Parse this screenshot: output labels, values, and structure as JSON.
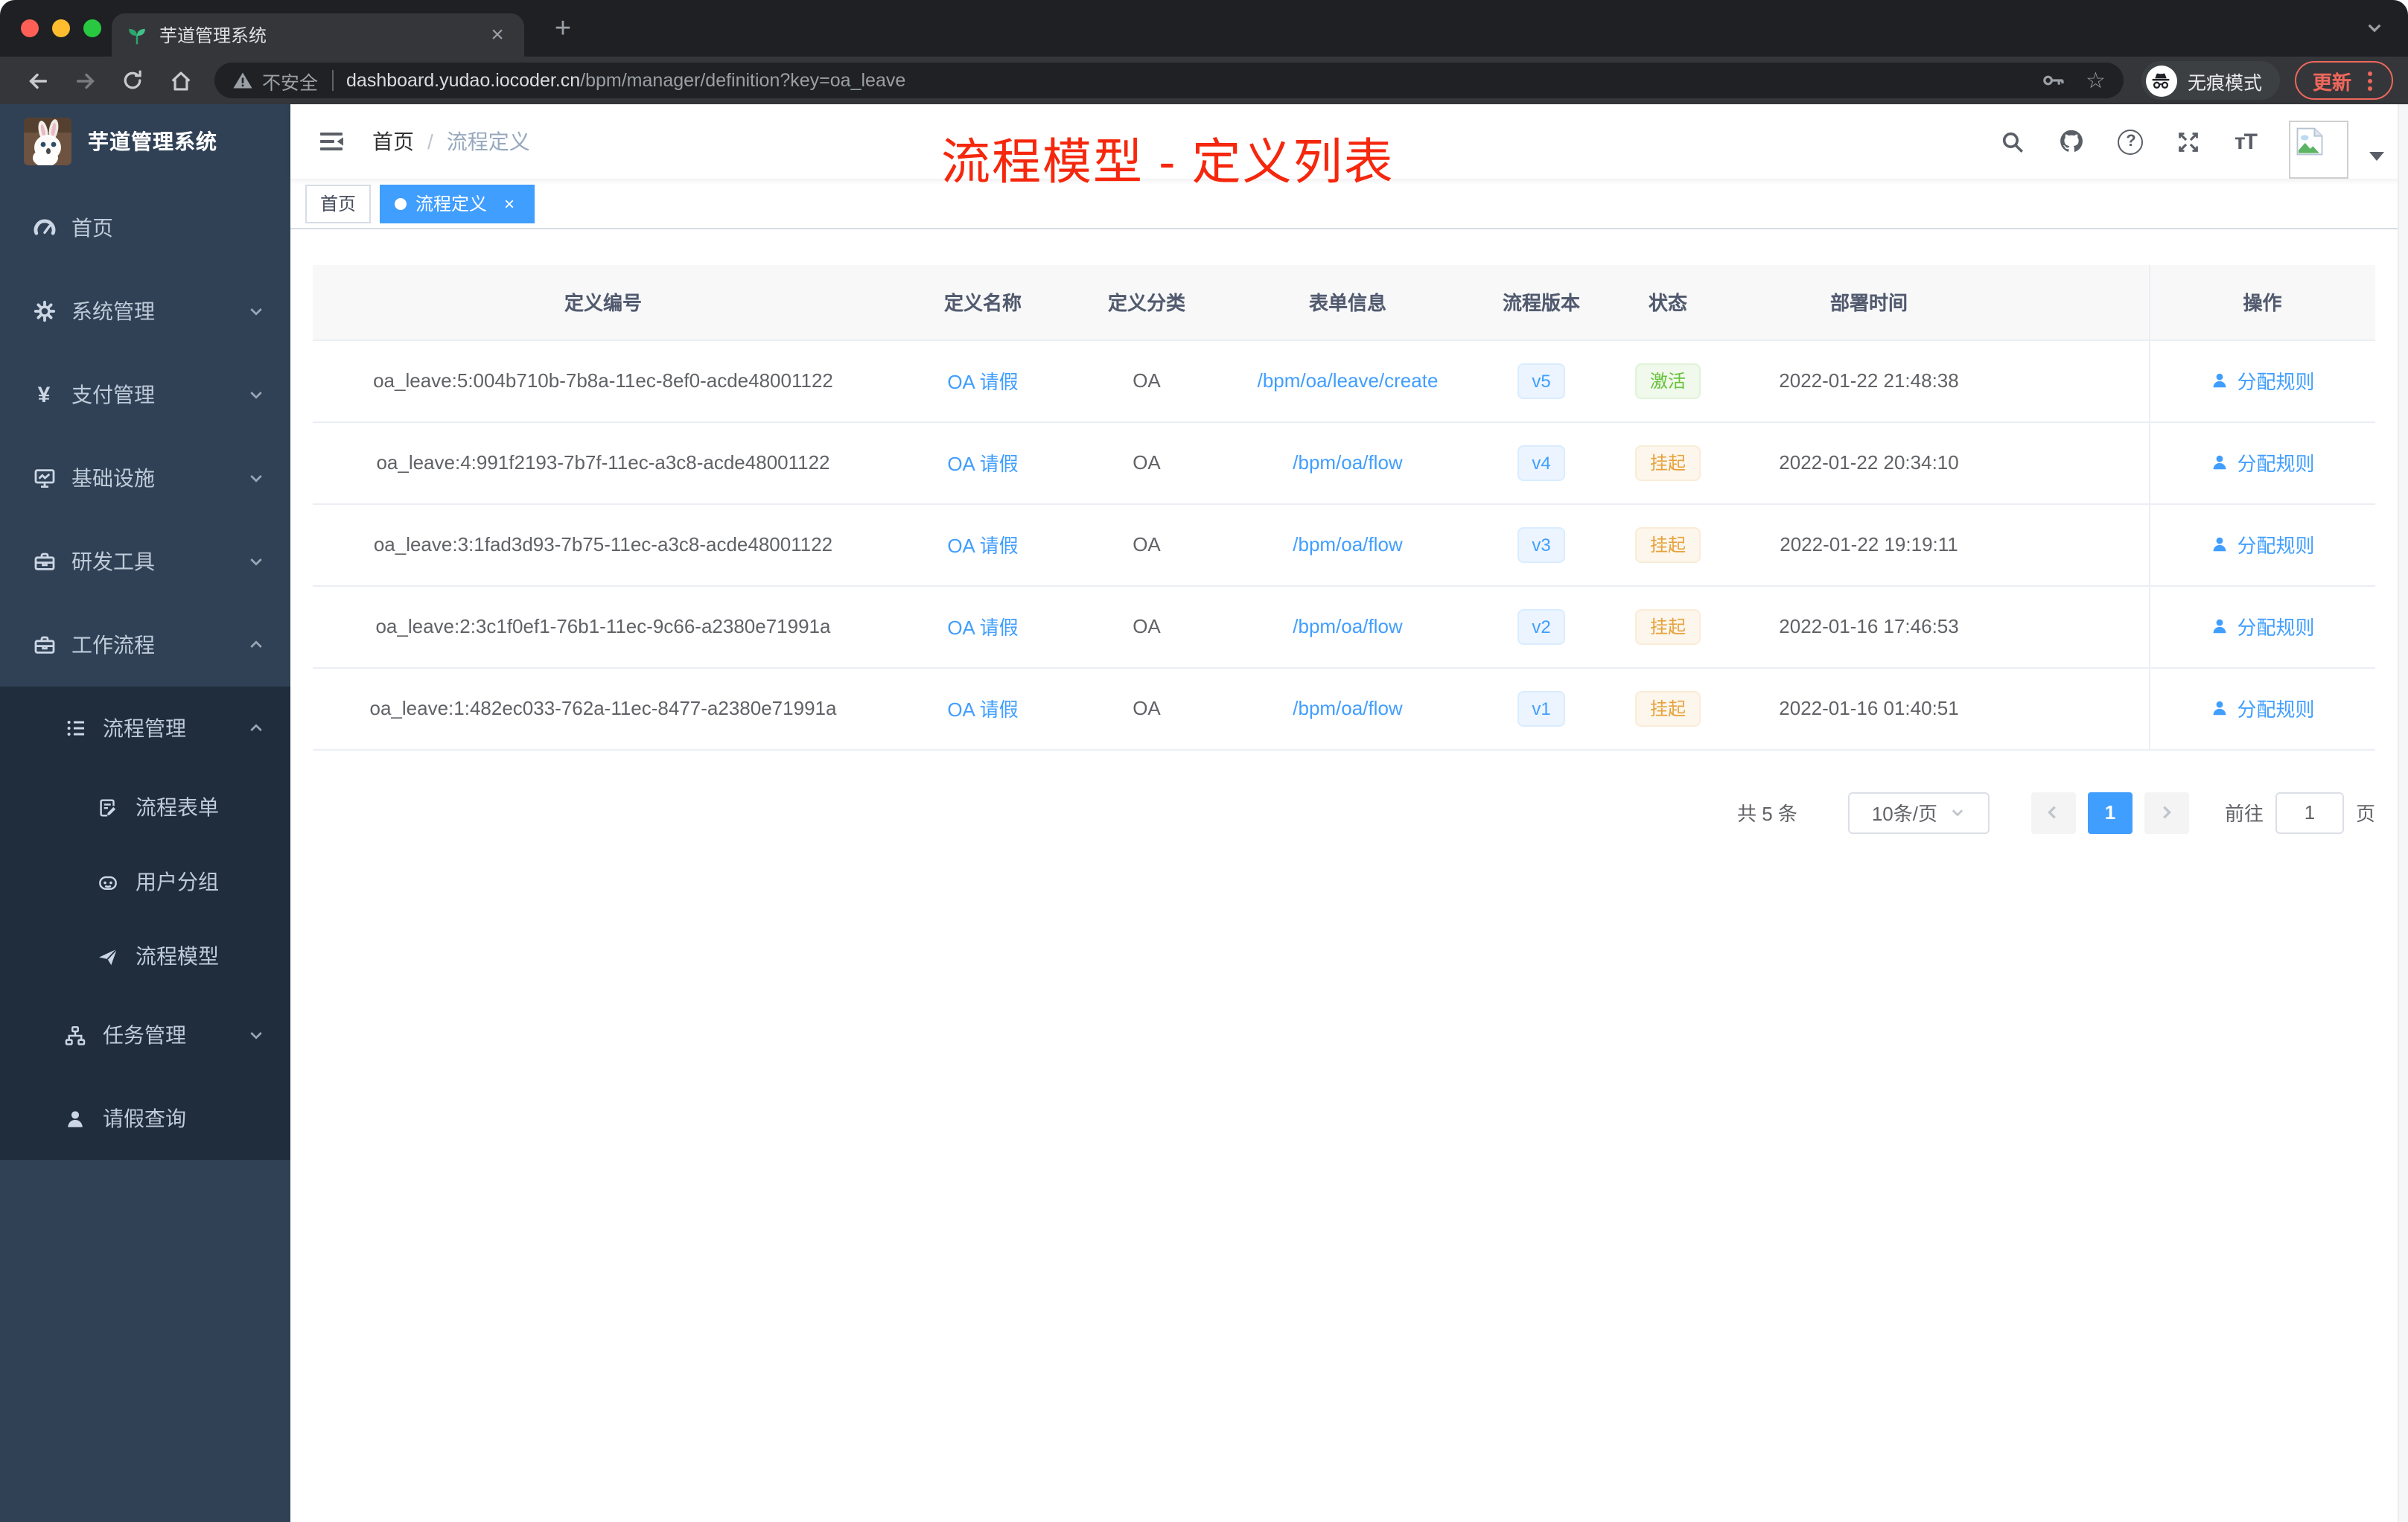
{
  "browser": {
    "tab_title": "芋道管理系统",
    "security_label": "不安全",
    "url_host": "dashboard.yudao.iocoder.cn",
    "url_path": "/bpm/manager/definition?key=oa_leave",
    "incognito_label": "无痕模式",
    "update_label": "更新"
  },
  "sidebar": {
    "logo_title": "芋道管理系统",
    "items": [
      {
        "label": "首页",
        "icon": "dashboard-icon",
        "level": 1
      },
      {
        "label": "系统管理",
        "icon": "gear-icon",
        "level": 1,
        "chevron": "down"
      },
      {
        "label": "支付管理",
        "icon": "yen-icon",
        "level": 1,
        "chevron": "down"
      },
      {
        "label": "基础设施",
        "icon": "monitor-icon",
        "level": 1,
        "chevron": "down"
      },
      {
        "label": "研发工具",
        "icon": "toolbox-icon",
        "level": 1,
        "chevron": "down"
      },
      {
        "label": "工作流程",
        "icon": "briefcase-icon",
        "level": 1,
        "chevron": "up"
      },
      {
        "label": "流程管理",
        "icon": "list-tree-icon",
        "level": 2,
        "chevron": "up"
      },
      {
        "label": "流程表单",
        "icon": "form-icon",
        "level": 3
      },
      {
        "label": "用户分组",
        "icon": "robot-icon",
        "level": 3
      },
      {
        "label": "流程模型",
        "icon": "paper-plane-icon",
        "level": 3
      },
      {
        "label": "任务管理",
        "icon": "tree-icon",
        "level": 2,
        "chevron": "down"
      },
      {
        "label": "请假查询",
        "icon": "user-icon",
        "level": 2
      }
    ]
  },
  "header": {
    "breadcrumb": {
      "home": "首页",
      "current": "流程定义"
    },
    "annotation": "流程模型 - 定义列表"
  },
  "tags": {
    "home": "首页",
    "active": "流程定义"
  },
  "table": {
    "columns": [
      "定义编号",
      "定义名称",
      "定义分类",
      "表单信息",
      "流程版本",
      "状态",
      "部署时间",
      "操作"
    ],
    "action_label": "分配规则",
    "rows": [
      {
        "id": "oa_leave:5:004b710b-7b8a-11ec-8ef0-acde48001122",
        "name": "OA 请假",
        "category": "OA",
        "form": "/bpm/oa/leave/create",
        "version": "v5",
        "status": "激活",
        "status_type": "success",
        "time": "2022-01-22 21:48:38"
      },
      {
        "id": "oa_leave:4:991f2193-7b7f-11ec-a3c8-acde48001122",
        "name": "OA 请假",
        "category": "OA",
        "form": "/bpm/oa/flow",
        "version": "v4",
        "status": "挂起",
        "status_type": "warning",
        "time": "2022-01-22 20:34:10"
      },
      {
        "id": "oa_leave:3:1fad3d93-7b75-11ec-a3c8-acde48001122",
        "name": "OA 请假",
        "category": "OA",
        "form": "/bpm/oa/flow",
        "version": "v3",
        "status": "挂起",
        "status_type": "warning",
        "time": "2022-01-22 19:19:11"
      },
      {
        "id": "oa_leave:2:3c1f0ef1-76b1-11ec-9c66-a2380e71991a",
        "name": "OA 请假",
        "category": "OA",
        "form": "/bpm/oa/flow",
        "version": "v2",
        "status": "挂起",
        "status_type": "warning",
        "time": "2022-01-16 17:46:53"
      },
      {
        "id": "oa_leave:1:482ec033-762a-11ec-8477-a2380e71991a",
        "name": "OA 请假",
        "category": "OA",
        "form": "/bpm/oa/flow",
        "version": "v1",
        "status": "挂起",
        "status_type": "warning",
        "time": "2022-01-16 01:40:51"
      }
    ]
  },
  "pagination": {
    "total": "共 5 条",
    "page_size": "10条/页",
    "page": "1",
    "goto": "前往",
    "unit": "页",
    "goto_value": "1"
  },
  "colors": {
    "accent": "#409eff",
    "sidebar_bg": "#304156",
    "submenu_bg": "#1f2d3d",
    "annotation_red": "#f5270d",
    "status_active": "#67c23a",
    "status_suspend": "#e6a23c"
  }
}
